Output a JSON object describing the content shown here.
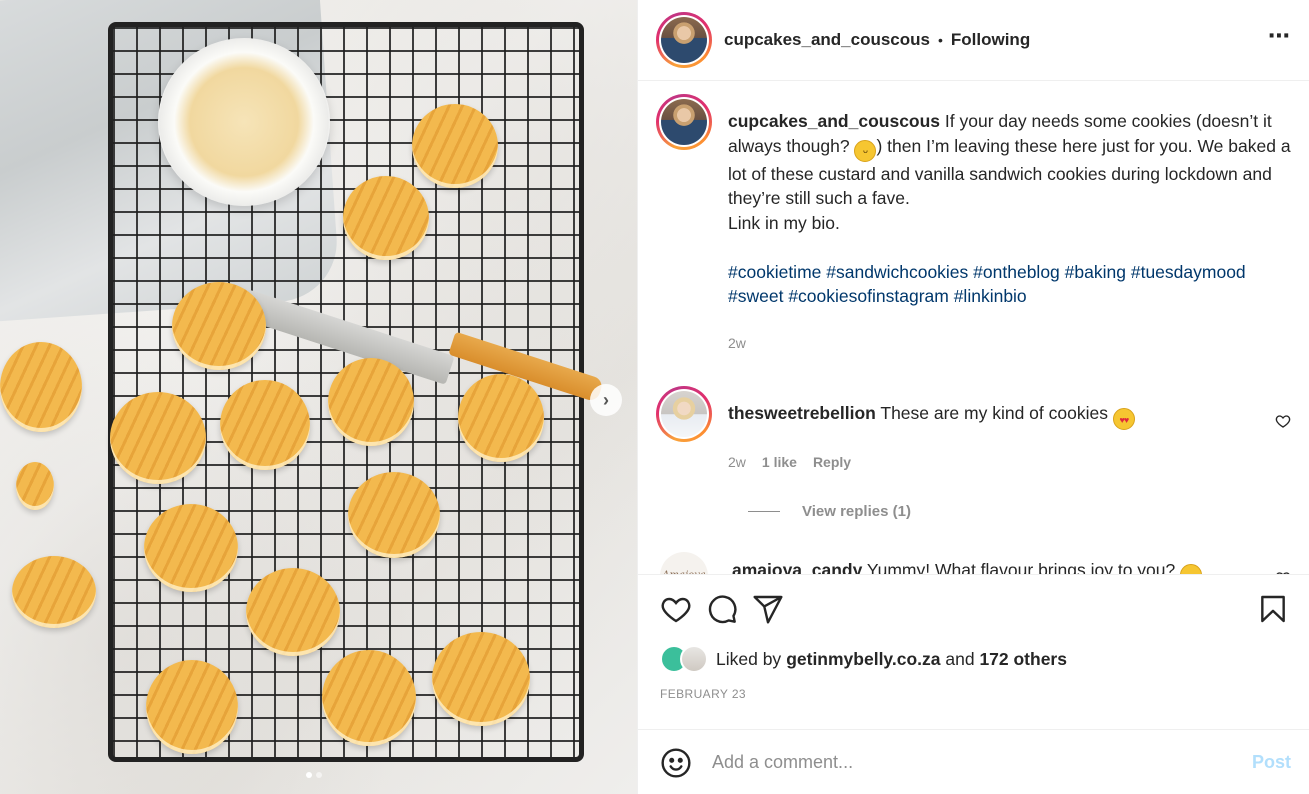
{
  "post": {
    "author": "cupcakes_and_couscous",
    "follow_status": "Following",
    "separator": "•",
    "more_icon": "⋯"
  },
  "caption": {
    "username": "cupcakes_and_couscous",
    "text_part1": " If your day needs some cookies (doesn’t it always though? ",
    "emoji": "grinning-face",
    "emoji_glyph": "ᵕ",
    "text_part2": ") then I’m leaving these here just for you. We baked a lot of these custard and vanilla sandwich cookies during lockdown and they’re still such a fave.",
    "text_line2": "Link in my bio.",
    "hashtags": [
      "#cookietime",
      "#sandwichcookies",
      "#ontheblog",
      "#baking",
      "#tuesdaymood",
      "#sweet",
      "#cookiesofinstagram",
      "#linkinbio"
    ],
    "time": "2w"
  },
  "comments": [
    {
      "username": "thesweetrebellion",
      "text": " These are my kind of cookies ",
      "emoji": "heart-eyes",
      "emoji_glyph": "♥♥",
      "time": "2w",
      "likes": "1 like",
      "reply_label": "Reply",
      "view_replies": "View replies (1)"
    },
    {
      "username": "amajoya_candy",
      "text": " Yummy! What flavour brings joy to you? ",
      "emoji": "hugging-face",
      "emoji_glyph": "ᵕ",
      "avatar_text": "Amajoya"
    }
  ],
  "likes": {
    "prefix": "Liked by ",
    "liker": "getinmybelly.co.za",
    "middle": " and ",
    "others": "172 others"
  },
  "date": "FEBRUARY 23",
  "comment_box": {
    "placeholder": "Add a comment...",
    "post_label": "Post"
  },
  "carousel": {
    "next_icon": "›",
    "current_index": 1,
    "total": 2
  },
  "colors": {
    "hashtag": "#00376b",
    "secondary_text": "#8e8e8e",
    "post_button_disabled": "#b2dffc"
  }
}
